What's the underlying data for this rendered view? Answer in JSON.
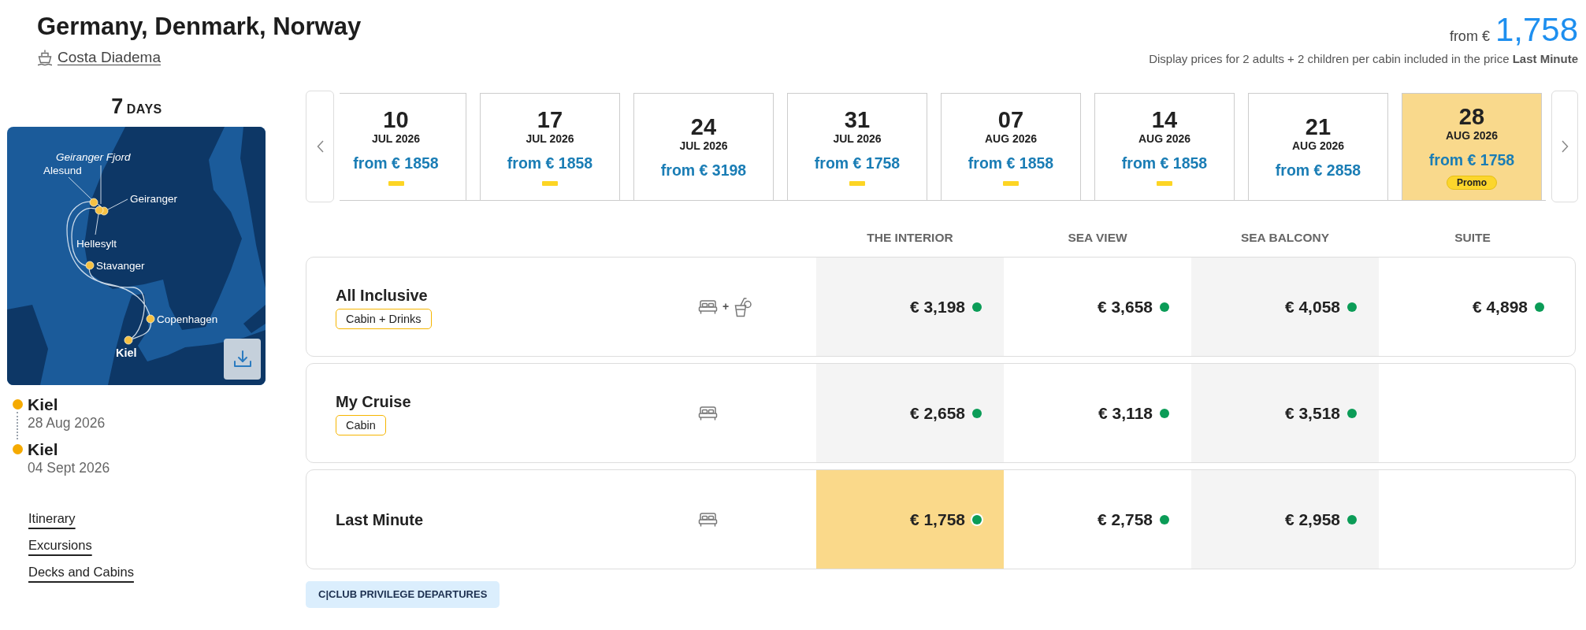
{
  "header": {
    "title": "Germany, Denmark, Norway",
    "ship": "Costa Diadema",
    "price": {
      "prefix": "from €",
      "amount": "1,758"
    },
    "note": "Display prices for 2 adults + 2 children per cabin included in the price **Last Minute**"
  },
  "sidebar": {
    "duration": {
      "number": "7",
      "unit": "DAYS"
    },
    "map": {
      "ports": [
        {
          "name": "Geiranger Fjord",
          "kind": "scenic"
        },
        {
          "name": "Alesund",
          "kind": "port"
        },
        {
          "name": "Geiranger",
          "kind": "port"
        },
        {
          "name": "Hellesylt",
          "kind": "port"
        },
        {
          "name": "Stavanger",
          "kind": "port"
        },
        {
          "name": "Copenhagen",
          "kind": "port"
        },
        {
          "name": "Kiel",
          "kind": "home"
        }
      ]
    },
    "stops": [
      {
        "port": "Kiel",
        "date": "28 Aug 2026"
      },
      {
        "port": "Kiel",
        "date": "04 Sept 2026"
      }
    ],
    "links": [
      "Itinerary",
      "Excursions",
      "Decks and Cabins"
    ]
  },
  "departures": [
    {
      "day": "10",
      "month": "JUL 2026",
      "price": "from € 1858",
      "promo": true,
      "selected": false
    },
    {
      "day": "17",
      "month": "JUL 2026",
      "price": "from € 1858",
      "promo": true,
      "selected": false
    },
    {
      "day": "24",
      "month": "JUL 2026",
      "price": "from € 3198",
      "promo": false,
      "selected": false
    },
    {
      "day": "31",
      "month": "JUL 2026",
      "price": "from € 1758",
      "promo": true,
      "selected": false
    },
    {
      "day": "07",
      "month": "AUG 2026",
      "price": "from € 1858",
      "promo": true,
      "selected": false
    },
    {
      "day": "14",
      "month": "AUG 2026",
      "price": "from € 1858",
      "promo": true,
      "selected": false
    },
    {
      "day": "21",
      "month": "AUG 2026",
      "price": "from € 2858",
      "promo": false,
      "selected": false
    },
    {
      "day": "28",
      "month": "AUG 2026",
      "price": "from € 1758",
      "promo": true,
      "badge": "Promo",
      "selected": true
    }
  ],
  "fares": {
    "columns": [
      "THE INTERIOR",
      "SEA VIEW",
      "SEA BALCONY",
      "SUITE"
    ],
    "rows": [
      {
        "name": "All Inclusive",
        "tag": "Cabin + Drinks",
        "services": [
          {
            "kind": "cabin"
          },
          {
            "kind": "drinks"
          }
        ],
        "joiner": "+",
        "cells": [
          {
            "price": "€ 3,198",
            "available": true,
            "selected": false
          },
          {
            "price": "€ 3,658",
            "available": true,
            "selected": false
          },
          {
            "price": "€ 4,058",
            "available": true,
            "selected": false
          },
          {
            "price": "€ 4,898",
            "available": true,
            "selected": false
          }
        ]
      },
      {
        "name": "My Cruise",
        "tag": "Cabin",
        "services": [
          {
            "kind": "cabin"
          }
        ],
        "cells": [
          {
            "price": "€ 2,658",
            "available": true,
            "selected": false
          },
          {
            "price": "€ 3,118",
            "available": true,
            "selected": false
          },
          {
            "price": "€ 3,518",
            "available": true,
            "selected": false
          }
        ]
      },
      {
        "name": "Last Minute",
        "services": [
          {
            "kind": "cabin"
          }
        ],
        "cells": [
          {
            "price": "€ 1,758",
            "available": true,
            "selected": true
          },
          {
            "price": "€ 2,758",
            "available": true,
            "selected": false
          },
          {
            "price": "€ 2,958",
            "available": true,
            "selected": false
          }
        ]
      }
    ]
  },
  "club_button": "C|CLUB PRIVILEGE DEPARTURES"
}
